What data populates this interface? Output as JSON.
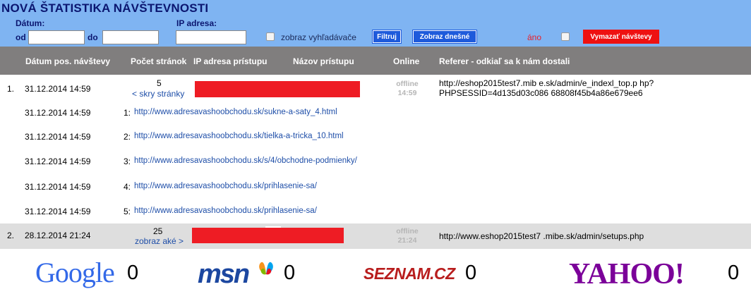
{
  "header": {
    "title": "NOVÁ ŠTATISTIKA NÁVŠTEVNOSTI",
    "date_label": "Dátum:",
    "from_label": "od",
    "to_label": "do",
    "ip_label": "IP adresa:",
    "from_value": "",
    "to_value": "",
    "ip_value": "",
    "show_search_label": "zobraz vyhľadávače",
    "filter_button": "Filtruj",
    "today_button": "Zobraz dnešné",
    "yes_label": "áno",
    "delete_button": "Vymazať návštevy"
  },
  "columns": {
    "date": "Dátum pos. návštevy",
    "pages": "Počet stránok",
    "ip": "IP adresa prístupu",
    "name": "Názov prístupu",
    "online": "Online",
    "referer": "Referer - odkiaľ sa k nám dostali"
  },
  "visits": [
    {
      "index": "1.",
      "date": "31.12.2014 14:59",
      "count": "5",
      "toggle": "< skry stránky",
      "status": "offline",
      "status_time": "14:59",
      "referer_line1": "http://eshop2015test7.mib e.sk/admin/e_indexl_top.p hp?",
      "referer_line2": "PHPSESSID=4d135d03c086 68808f45b4a86e679ee6",
      "pages": [
        {
          "date": "31.12.2014 14:59",
          "num": "1:",
          "url": "http://www.adresavashoobchodu.sk/sukne-a-saty_4.html"
        },
        {
          "date": "31.12.2014 14:59",
          "num": "2:",
          "url": "http://www.adresavashoobchodu.sk/tielka-a-tricka_10.html"
        },
        {
          "date": "31.12.2014 14:59",
          "num": "3:",
          "url": "http://www.adresavashoobchodu.sk/s/4/obchodne-podmienky/"
        },
        {
          "date": "31.12.2014 14:59",
          "num": "4:",
          "url": "http://www.adresavashoobchodu.sk/prihlasenie-sa/"
        },
        {
          "date": "31.12.2014 14:59",
          "num": "5:",
          "url": "http://www.adresavashoobchodu.sk/prihlasenie-sa/"
        }
      ]
    },
    {
      "index": "2.",
      "date": "28.12.2014 21:24",
      "count": "25",
      "toggle": "zobraz aké >",
      "status": "offline",
      "status_time": "21:24",
      "referer_line1": "http://www.eshop2015test7 .mibe.sk/admin/setups.php"
    }
  ],
  "engines": {
    "google": {
      "logo_text": "Google",
      "count": "0"
    },
    "msn": {
      "logo_text": "msn",
      "count": "0"
    },
    "seznam": {
      "logo_text": "SEZNAM.CZ",
      "count": "0"
    },
    "yahoo": {
      "logo_text": "YAHOO!",
      "count": "0"
    }
  },
  "colors": {
    "header_bg": "#7fb4f2",
    "title": "#0b1670",
    "table_header_bg": "#807e7e",
    "button_blue": "#1e5adb",
    "button_red": "#ee1111",
    "link": "#1e4ea8",
    "redaction": "#ee1c24"
  }
}
